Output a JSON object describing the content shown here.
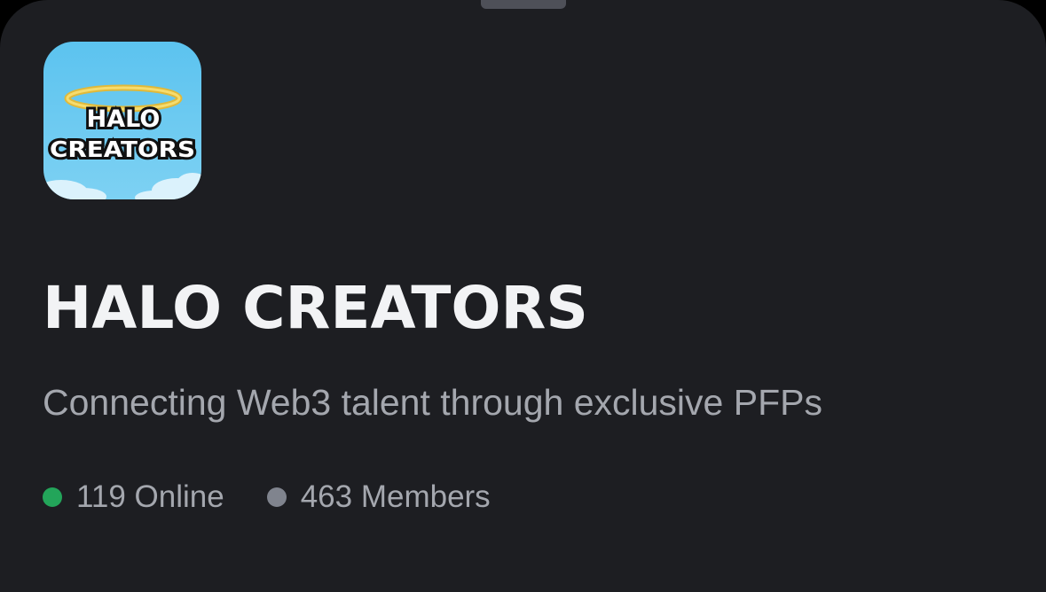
{
  "server": {
    "icon_name": "halo-creators-logo",
    "icon_text_line1": "HALO",
    "icon_text_line2": "CREATORS",
    "name": "HALO CREATORS",
    "description": "Connecting Web3 talent through exclusive PFPs"
  },
  "stats": {
    "online_label": "119 Online",
    "members_label": "463 Members",
    "online_color": "#23a55a",
    "members_color": "#80848e"
  },
  "colors": {
    "sheet_background": "#1d1e22",
    "title": "#f2f3f5",
    "secondary_text": "#a4a7ae",
    "icon_sky": "#5cc3ef",
    "halo": "#f2d15c"
  }
}
